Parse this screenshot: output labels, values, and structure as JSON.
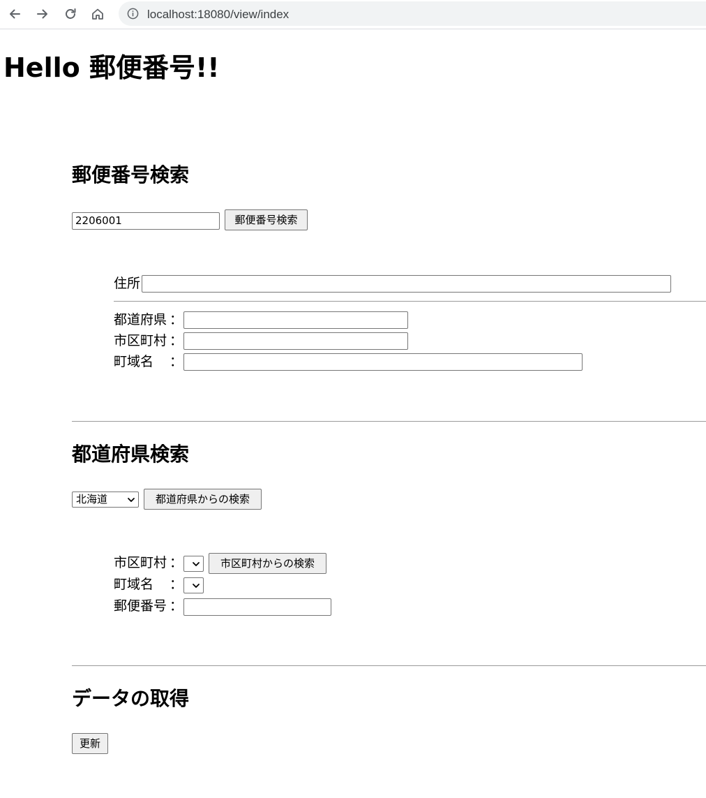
{
  "browser": {
    "url": "localhost:18080/view/index",
    "icons": [
      "back-arrow-icon",
      "forward-arrow-icon",
      "reload-icon",
      "home-icon",
      "info-icon"
    ]
  },
  "page": {
    "title": "Hello 郵便番号!!"
  },
  "zipcode_search": {
    "heading": "郵便番号検索",
    "zipcode_value": "2206001",
    "search_button": "郵便番号検索",
    "address_label": "住所",
    "address_value": "",
    "prefecture_label": "都道府県",
    "prefecture_value": "",
    "city_label": "市区町村",
    "city_value": "",
    "town_label": "町域名",
    "town_value": "",
    "colon": "："
  },
  "prefecture_search": {
    "heading": "都道府県検索",
    "prefecture_selected": "北海道",
    "search_button": "都道府県からの検索",
    "city_label": "市区町村",
    "city_selected": "",
    "city_search_button": "市区町村からの検索",
    "town_label": "町域名",
    "town_selected": "",
    "zipcode_label": "郵便番号",
    "zipcode_value": "",
    "colon": "："
  },
  "data_fetch": {
    "heading": "データの取得",
    "refresh_button": "更新"
  }
}
